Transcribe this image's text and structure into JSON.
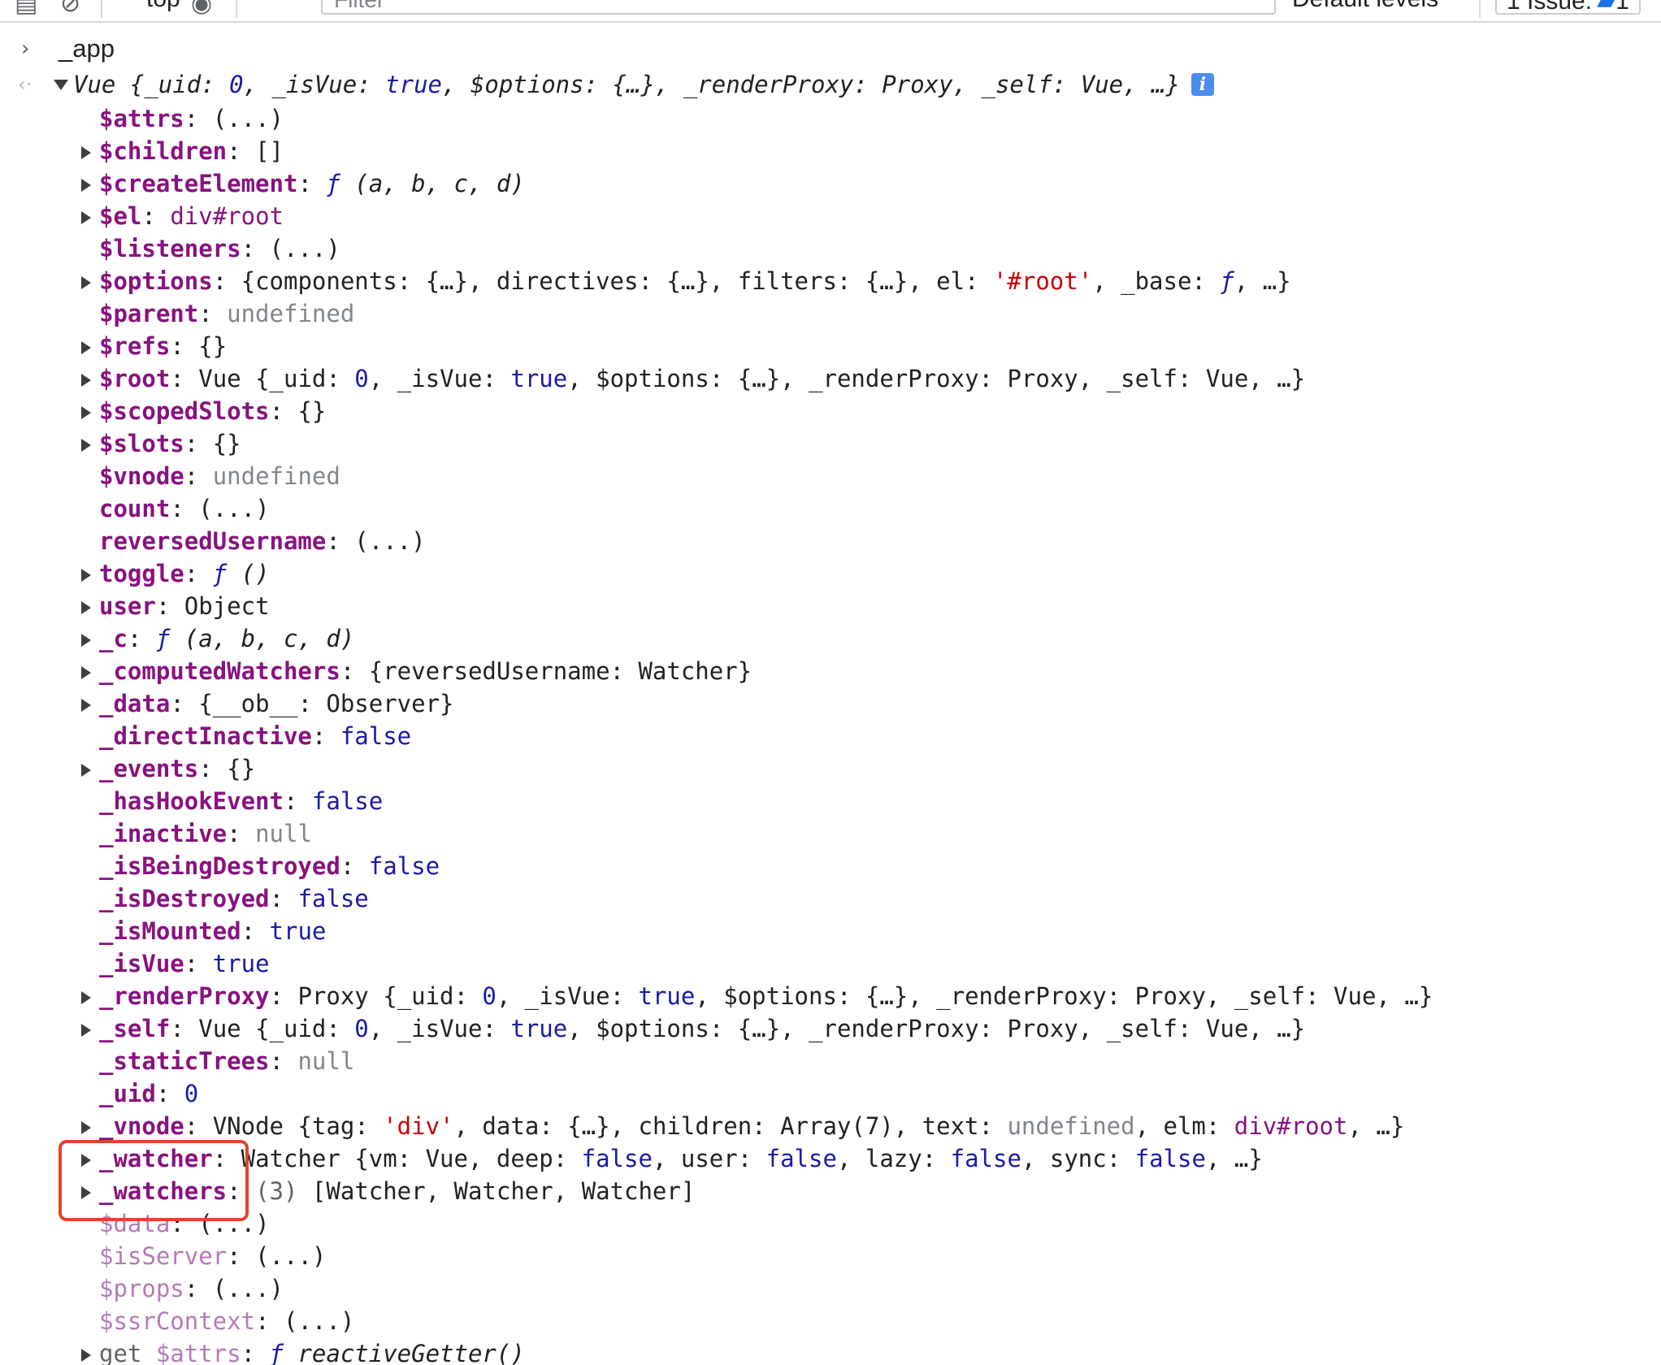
{
  "toolbar": {
    "context": "top",
    "filter_placeholder": "Filter",
    "levels": "Default levels",
    "issues_label": "1 Issue:",
    "issues_count": "1"
  },
  "console": {
    "command": "_app",
    "summary": {
      "prefix": "Vue ",
      "open": "{",
      "parts": [
        {
          "key": "_uid",
          "value": "0",
          "type": "num"
        },
        {
          "key": "_isVue",
          "value": "true",
          "type": "bool"
        },
        {
          "key": "$options",
          "value": "{…}",
          "type": "plain"
        },
        {
          "key": "_renderProxy",
          "value": "Proxy",
          "type": "plain"
        },
        {
          "key": "_self",
          "value": "Vue",
          "type": "plain"
        }
      ],
      "tail": ", …}"
    },
    "properties": [
      {
        "key": "$attrs",
        "expandable": false,
        "value": "(...)"
      },
      {
        "key": "$children",
        "expandable": true,
        "value": "[]"
      },
      {
        "key": "$createElement",
        "expandable": true,
        "fn": "ƒ",
        "sig": " (a, b, c, d)"
      },
      {
        "key": "$el",
        "expandable": true,
        "tag": "div#root"
      },
      {
        "key": "$listeners",
        "expandable": false,
        "value": "(...)"
      },
      {
        "key": "$options",
        "expandable": true,
        "value": "{components: {…}, directives: {…}, filters: {…}, el: ",
        "str": "'#root'",
        "after": ", _base: ",
        "fn2": "ƒ",
        "end": ", …}"
      },
      {
        "key": "$parent",
        "expandable": false,
        "undef": "undefined"
      },
      {
        "key": "$refs",
        "expandable": true,
        "value": "{}"
      },
      {
        "key": "$root",
        "expandable": true,
        "value": "Vue {_uid: ",
        "num": "0",
        "after": ", _isVue: ",
        "bool": "true",
        "end": ", $options: {…}, _renderProxy: Proxy, _self: Vue, …}"
      },
      {
        "key": "$scopedSlots",
        "expandable": true,
        "value": "{}"
      },
      {
        "key": "$slots",
        "expandable": true,
        "value": "{}"
      },
      {
        "key": "$vnode",
        "expandable": false,
        "undef": "undefined"
      },
      {
        "key": "count",
        "expandable": false,
        "value": "(...)"
      },
      {
        "key": "reversedUsername",
        "expandable": false,
        "value": "(...)"
      },
      {
        "key": "toggle",
        "expandable": true,
        "fn": "ƒ",
        "sig": " ()"
      },
      {
        "key": "user",
        "expandable": true,
        "value": "Object"
      },
      {
        "key": "_c",
        "expandable": true,
        "fn": "ƒ",
        "sig": " (a, b, c, d)"
      },
      {
        "key": "_computedWatchers",
        "expandable": true,
        "value": "{reversedUsername: Watcher}"
      },
      {
        "key": "_data",
        "expandable": true,
        "value": "{__ob__: Observer}"
      },
      {
        "key": "_directInactive",
        "expandable": false,
        "bool": "false"
      },
      {
        "key": "_events",
        "expandable": true,
        "value": "{}"
      },
      {
        "key": "_hasHookEvent",
        "expandable": false,
        "bool": "false"
      },
      {
        "key": "_inactive",
        "expandable": false,
        "undef": "null"
      },
      {
        "key": "_isBeingDestroyed",
        "expandable": false,
        "bool": "false"
      },
      {
        "key": "_isDestroyed",
        "expandable": false,
        "bool": "false"
      },
      {
        "key": "_isMounted",
        "expandable": false,
        "bool": "true"
      },
      {
        "key": "_isVue",
        "expandable": false,
        "bool": "true"
      },
      {
        "key": "_renderProxy",
        "expandable": true,
        "value": "Proxy {_uid: ",
        "num": "0",
        "after": ", _isVue: ",
        "bool": "true",
        "end": ", $options: {…}, _renderProxy: Proxy, _self: Vue, …}"
      },
      {
        "key": "_self",
        "expandable": true,
        "value": "Vue {_uid: ",
        "num": "0",
        "after": ", _isVue: ",
        "bool": "true",
        "end": ", $options: {…}, _renderProxy: Proxy, _self: Vue, …}"
      },
      {
        "key": "_staticTrees",
        "expandable": false,
        "undef": "null"
      },
      {
        "key": "_uid",
        "expandable": false,
        "num": "0"
      },
      {
        "key": "_vnode",
        "expandable": true,
        "value": "VNode {tag: ",
        "str": "'div'",
        "after": ", data: {…}, children: Array(7), text: ",
        "undef2": "undefined",
        "after2": ", elm: ",
        "tag2": "div#root",
        "end": ", …}"
      },
      {
        "key": "_watcher",
        "expandable": true,
        "value": "Watcher {vm: Vue, deep: ",
        "b1": "false",
        "a1": ", user: ",
        "b2": "false",
        "a2": ", lazy: ",
        "b3": "false",
        "a3": ", sync: ",
        "b4": "false",
        "end": ", …}"
      },
      {
        "key": "_watchers",
        "expandable": true,
        "count": "(3) ",
        "value": "[Watcher, Watcher, Watcher]"
      },
      {
        "key": "$data",
        "expandable": false,
        "faded": true,
        "value": "(...)"
      },
      {
        "key": "$isServer",
        "expandable": false,
        "faded": true,
        "value": "(...)"
      },
      {
        "key": "$props",
        "expandable": false,
        "faded": true,
        "value": "(...)"
      },
      {
        "key": "$ssrContext",
        "expandable": false,
        "faded": true,
        "value": "(...)"
      },
      {
        "key": "$attrs",
        "expandable": true,
        "faded": true,
        "getter": "get ",
        "fn": "ƒ",
        "sig": " reactiveGetter()"
      }
    ]
  }
}
